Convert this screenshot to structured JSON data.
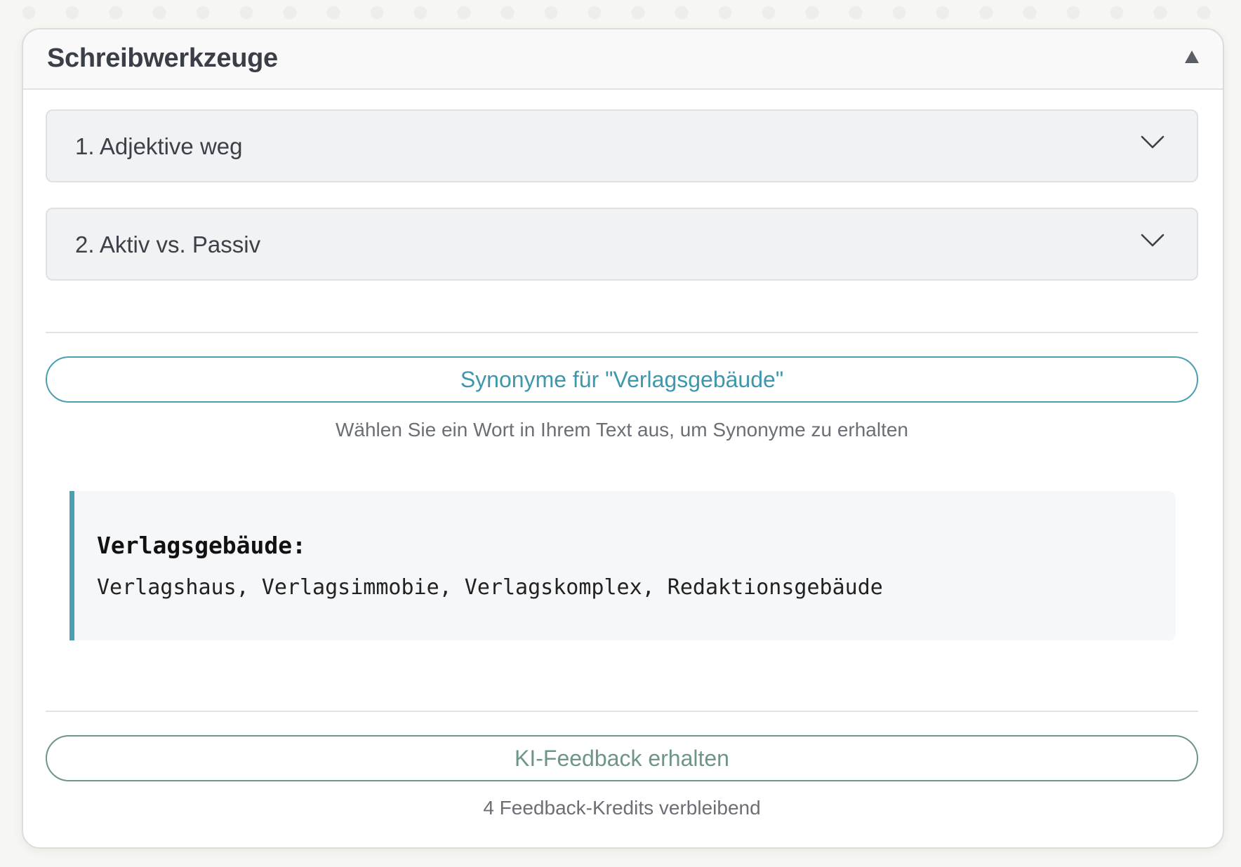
{
  "panel": {
    "title": "Schreibwerkzeuge",
    "collapse_icon": "triangle-up-icon"
  },
  "accordion": {
    "items": [
      {
        "label": "1. Adjektive weg",
        "icon": "chevron-down-icon"
      },
      {
        "label": "2. Aktiv vs. Passiv",
        "icon": "chevron-down-icon"
      }
    ]
  },
  "synonyms": {
    "button_label": "Synonyme für \"Verlagsgebäude\"",
    "hint": "Wählen Sie ein Wort in Ihrem Text aus, um Synonyme zu erhalten",
    "result_word": "Verlagsgebäude:",
    "result_list": "Verlagshaus, Verlagsimmobie, Verlagskomplex, Redaktionsgebäude"
  },
  "feedback": {
    "button_label": "KI-Feedback erhalten",
    "credits_text": "4 Feedback-Kredits verbleibend"
  },
  "colors": {
    "accent_teal": "#4a9fb3",
    "feedback_green": "#6d958a",
    "panel_bg": "#ffffff",
    "accordion_bg": "#f1f2f4"
  }
}
